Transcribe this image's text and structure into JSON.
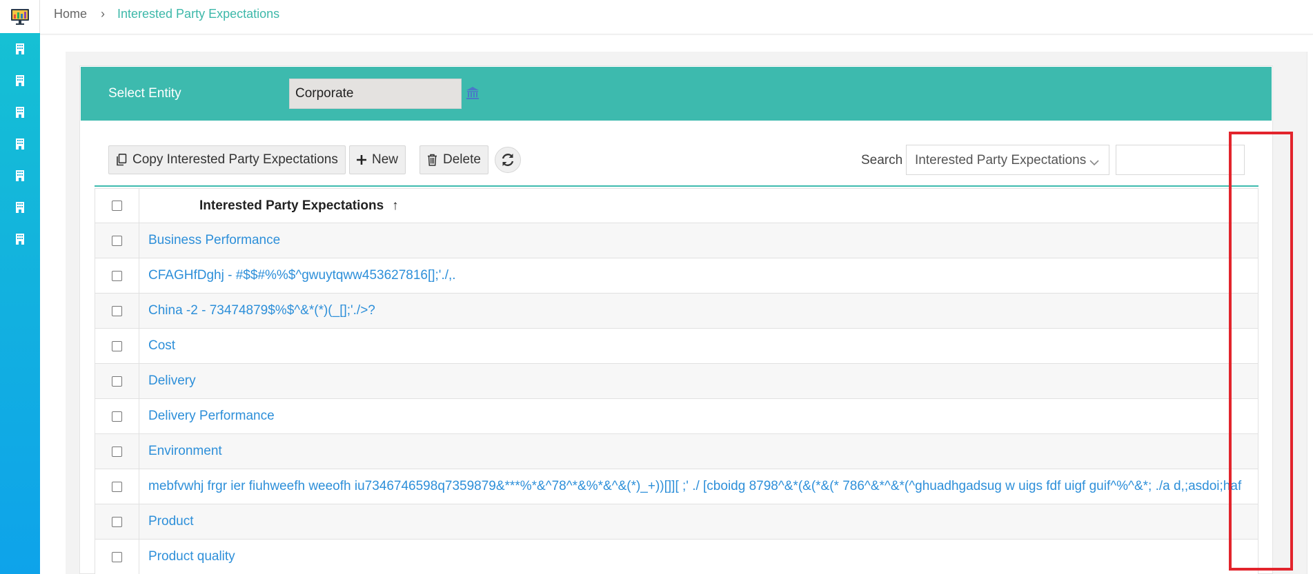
{
  "breadcrumb": {
    "home": "Home",
    "separator": "›",
    "current": "Interested Party Expectations"
  },
  "sidebar": {
    "logo_icon": "monitor-chart-logo",
    "items": [
      {
        "icon": "building-icon"
      },
      {
        "icon": "building-icon"
      },
      {
        "icon": "building-icon"
      },
      {
        "icon": "building-icon"
      },
      {
        "icon": "building-icon"
      },
      {
        "icon": "building-icon"
      },
      {
        "icon": "building-icon"
      }
    ]
  },
  "entity": {
    "label": "Select Entity",
    "value": "Corporate",
    "icon": "institution-icon"
  },
  "toolbar": {
    "copy_label": "Copy Interested Party Expectations",
    "new_label": "New",
    "delete_label": "Delete",
    "refresh_icon": "refresh-icon"
  },
  "search": {
    "label": "Search",
    "field": "Interested Party Expectations",
    "value": ""
  },
  "table": {
    "header": "Interested Party Expectations",
    "sort_indicator": "↑",
    "rows": [
      "Business Performance",
      "CFAGHfDghj - #$$#%%$^gwuytqww453627816[];'./,.",
      "China -2 - 73474879$%$^&*(*)(_[];'./>?",
      "Cost",
      "Delivery",
      "Delivery Performance",
      "Environment",
      "mebfvwhj frgr ier fiuhweefh weeofh iu7346746598q7359879&***%*&^78^*&%*&^&(*)_+))[]][ ;' ./ [cboidg 8798^&*(&(*&(* 786^&*^&*(^ghuadhgadsug w uigs fdf uigf guif^%^&*; ./a d,;asdoi;haf",
      "Product",
      "Product quality"
    ]
  },
  "colors": {
    "accent": "#3dbaae",
    "link": "#2d8fd9",
    "sidebar": "#12b0e0",
    "highlight": "#e2242c"
  }
}
